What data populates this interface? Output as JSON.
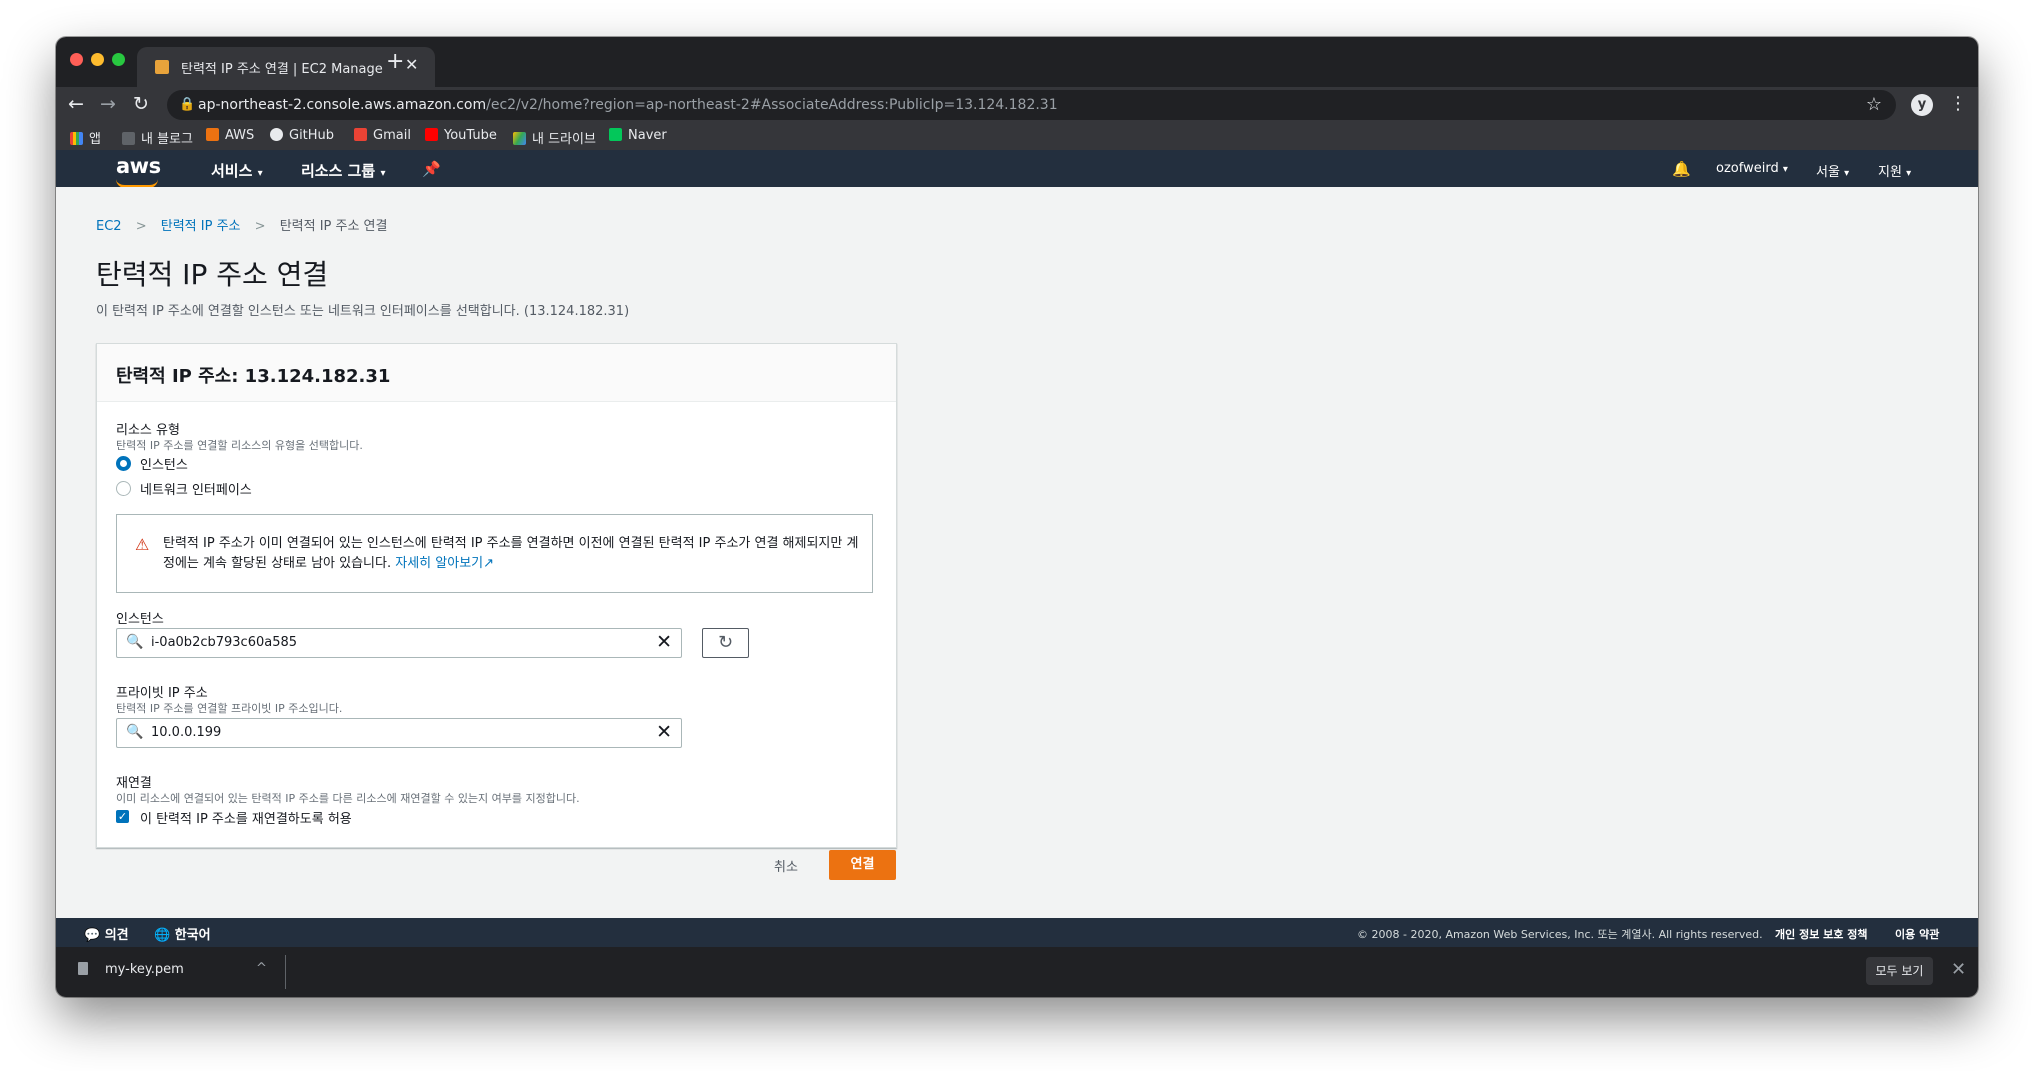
{
  "browser": {
    "tab_title": "탄력적 IP 주소 연결 | EC2 Manage",
    "url_host": "ap-northeast-2.console.aws.amazon.com",
    "url_path": "/ec2/v2/home?region=ap-northeast-2#AssociateAddress:PublicIp=13.124.182.31",
    "bookmarks": [
      "앱",
      "내 블로그",
      "AWS",
      "GitHub",
      "Gmail",
      "YouTube",
      "내 드라이브",
      "Naver"
    ]
  },
  "aws_nav": {
    "logo": "aws",
    "services": "서비스",
    "resource_groups": "리소스 그룹",
    "user": "ozofweird",
    "region": "서울",
    "support": "지원"
  },
  "breadcrumb": [
    "EC2",
    "탄력적 IP 주소",
    "탄력적 IP 주소 연결"
  ],
  "page": {
    "title": "탄력적 IP 주소 연결",
    "description": "이 탄력적 IP 주소에 연결할 인스턴스 또는 네트워크 인터페이스를 선택합니다. (13.124.182.31)"
  },
  "panel": {
    "title": "탄력적 IP 주소: 13.124.182.31",
    "resource_type_label": "리소스 유형",
    "resource_type_hint": "탄력적 IP 주소를 연결할 리소스의 유형을 선택합니다.",
    "option_instance": "인스턴스",
    "option_network_interface": "네트워크 인터페이스",
    "selected_option": "인스턴스",
    "alert_text": "탄력적 IP 주소가 이미 연결되어 있는 인스턴스에 탄력적 IP 주소를 연결하면 이전에 연결된 탄력적 IP 주소가 연결 해제되지만 계정에는 계속 할당된 상태로 남아 있습니다.",
    "alert_link": "자세히 알아보기",
    "instance_label": "인스턴스",
    "instance_value": "i-0a0b2cb793c60a585",
    "private_ip_label": "프라이빗 IP 주소",
    "private_ip_hint": "탄력적 IP 주소를 연결할 프라이빗 IP 주소입니다.",
    "private_ip_value": "10.0.0.199",
    "reassoc_label": "재연결",
    "reassoc_hint": "이미 리소스에 연결되어 있는 탄력적 IP 주소를 다른 리소스에 재연결할 수 있는지 여부를 지정합니다.",
    "reassoc_checkbox": "이 탄력적 IP 주소를 재연결하도록 허용",
    "reassoc_checked": true
  },
  "actions": {
    "cancel": "취소",
    "connect": "연결"
  },
  "footer": {
    "feedback": "의견",
    "language": "한국어",
    "copyright": "© 2008 - 2020, Amazon Web Services, Inc. 또는 계열사. All rights reserved.",
    "privacy": "개인 정보 보호 정책",
    "terms": "이용 약관"
  },
  "downloads": {
    "file": "my-key.pem",
    "show_all": "모두 보기"
  },
  "colors": {
    "aws_nav": "#232f3e",
    "link": "#0073bb",
    "primary_button": "#ec7211",
    "warning": "#d13212"
  }
}
